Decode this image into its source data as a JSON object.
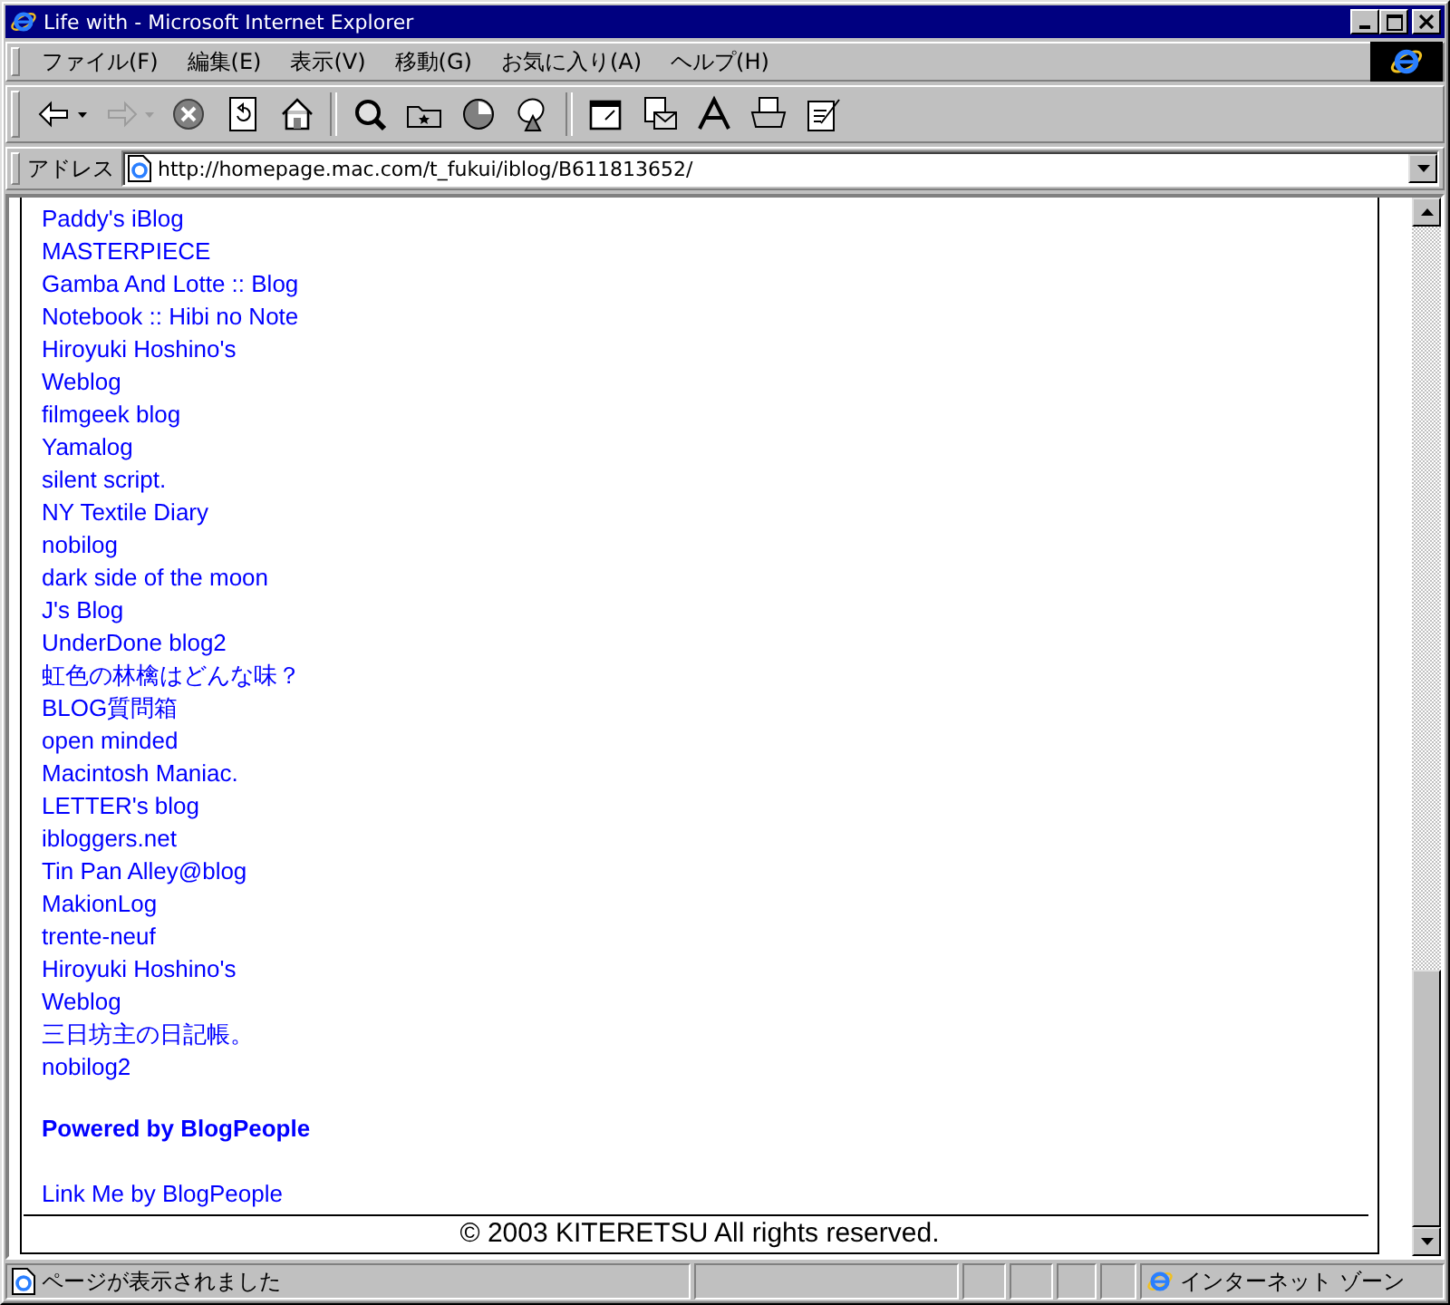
{
  "window": {
    "title": "Life with - Microsoft Internet Explorer"
  },
  "menu": [
    "ファイル(F)",
    "編集(E)",
    "表示(V)",
    "移動(G)",
    "お気に入り(A)",
    "ヘルプ(H)"
  ],
  "toolbar": [
    [
      {
        "kind": "back",
        "disabled": false,
        "dropdown": true
      },
      {
        "kind": "forward",
        "disabled": true,
        "dropdown": true
      },
      {
        "kind": "stop",
        "disabled": false,
        "dropdown": false
      },
      {
        "kind": "refresh",
        "disabled": false,
        "dropdown": false
      },
      {
        "kind": "home",
        "disabled": false,
        "dropdown": false
      }
    ],
    [
      {
        "kind": "search",
        "disabled": false,
        "dropdown": false
      },
      {
        "kind": "favorites",
        "disabled": false,
        "dropdown": false
      },
      {
        "kind": "history",
        "disabled": false,
        "dropdown": false
      },
      {
        "kind": "dish",
        "disabled": false,
        "dropdown": false
      }
    ],
    [
      {
        "kind": "window",
        "disabled": false,
        "dropdown": false
      },
      {
        "kind": "mail",
        "disabled": false,
        "dropdown": false
      },
      {
        "kind": "font",
        "disabled": false,
        "dropdown": false
      },
      {
        "kind": "print",
        "disabled": false,
        "dropdown": false
      },
      {
        "kind": "edit",
        "disabled": false,
        "dropdown": false
      }
    ]
  ],
  "address": {
    "label": "アドレス",
    "value": "http://homepage.mac.com/t_fukui/iblog/B611813652/"
  },
  "links": [
    "Paddy's iBlog",
    "MASTERPIECE",
    "Gamba And Lotte :: Blog",
    "Notebook :: Hibi no Note",
    "Hiroyuki Hoshino's",
    "Weblog",
    "filmgeek blog",
    "Yamalog",
    "silent script.",
    "NY Textile Diary",
    "nobilog",
    "dark side of the moon",
    "J's Blog",
    "UnderDone blog2",
    "虹色の林檎はどんな味？",
    "BLOG質問箱",
    "open minded",
    "Macintosh Maniac.",
    "LETTER's blog",
    "ibloggers.net",
    "Tin Pan Alley@blog",
    "MakionLog",
    "trente-neuf",
    "Hiroyuki Hoshino's",
    "Weblog",
    "三日坊主の日記帳。",
    "nobilog2"
  ],
  "powered": "Powered by BlogPeople",
  "link_me": "Link Me by BlogPeople",
  "footer": "© 2003 KITERETSU All rights reserved.",
  "status_bar": {
    "message": "ページが表示されました",
    "zone": "インターネット ゾーン"
  }
}
